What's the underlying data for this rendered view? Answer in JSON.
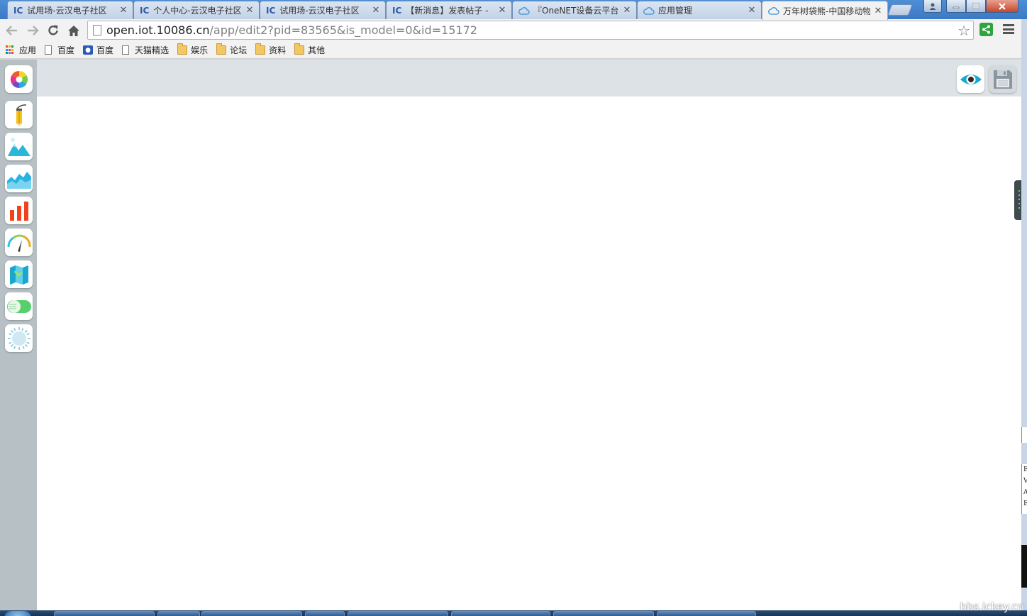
{
  "browser": {
    "tabs": [
      {
        "icon": "ic-logo-icon",
        "fav_text": "IC",
        "title": "试用场-云汉电子社区",
        "active": false
      },
      {
        "icon": "ic-logo-icon",
        "fav_text": "IC",
        "title": "个人中心-云汉电子社区",
        "active": false
      },
      {
        "icon": "ic-logo-icon",
        "fav_text": "IC",
        "title": "试用场-云汉电子社区",
        "active": false
      },
      {
        "icon": "ic-logo-icon",
        "fav_text": "IC",
        "title": "【新消息】发表帖子 -",
        "active": false
      },
      {
        "icon": "cloud-icon",
        "fav_text": "",
        "title": "『OneNET设备云平台",
        "active": false
      },
      {
        "icon": "cloud-icon",
        "fav_text": "",
        "title": "应用管理",
        "active": false
      },
      {
        "icon": "cloud-icon",
        "fav_text": "",
        "title": "万年树袋熊-中国移动物",
        "active": true
      }
    ],
    "close_glyph": "✕",
    "address": {
      "host": "open.iot.10086.cn",
      "path": "/app/edit2?pid=83565&is_model=0&id=15172"
    },
    "bookmarks": [
      {
        "icon": "apps-grid-icon",
        "label": "应用"
      },
      {
        "icon": "page-icon",
        "label": "百度"
      },
      {
        "icon": "baidu-paw-icon",
        "label": "百度"
      },
      {
        "icon": "page-icon",
        "label": "天猫精选"
      },
      {
        "icon": "folder-icon",
        "label": "娱乐"
      },
      {
        "icon": "folder-icon",
        "label": "论坛"
      },
      {
        "icon": "folder-icon",
        "label": "资料"
      },
      {
        "icon": "folder-icon",
        "label": "其他"
      }
    ]
  },
  "editor": {
    "left_tools": [
      {
        "name": "color-wheel-tool",
        "icon": "color-wheel-icon"
      },
      {
        "name": "text-pen-tool",
        "icon": "pencil-icon"
      },
      {
        "name": "image-tool",
        "icon": "mountain-image-icon"
      },
      {
        "name": "area-chart-tool",
        "icon": "area-chart-icon"
      },
      {
        "name": "bar-chart-tool",
        "icon": "bar-chart-icon"
      },
      {
        "name": "gauge-tool",
        "icon": "gauge-icon"
      },
      {
        "name": "map-tool",
        "icon": "map-icon"
      },
      {
        "name": "switch-tool",
        "icon": "switch-icon"
      },
      {
        "name": "light-tool",
        "icon": "light-bulb-icon"
      }
    ],
    "right_tools": [
      {
        "name": "preview-button",
        "icon": "eye-icon"
      },
      {
        "name": "save-button",
        "icon": "floppy-disk-icon"
      }
    ],
    "colors": {
      "top_panel": "#dde2e6",
      "left_rail": "#b6c0c5",
      "canvas": "#ffffff",
      "eye_accent": "#1aa7cf"
    }
  },
  "stray_window": {
    "lines": [
      "E",
      "V",
      "A",
      "E"
    ]
  },
  "watermark": "bbs.ickey.cn"
}
